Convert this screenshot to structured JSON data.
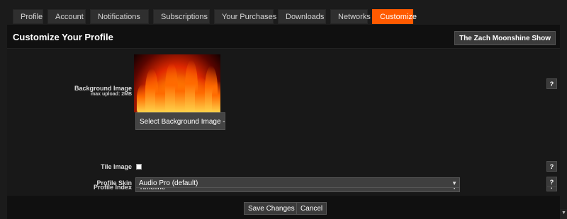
{
  "tabs": [
    {
      "label": "Profile"
    },
    {
      "label": "Account"
    },
    {
      "label": "Notifications"
    },
    {
      "label": "Subscriptions"
    },
    {
      "label": "Your Purchases"
    },
    {
      "label": "Downloads"
    },
    {
      "label": "Networks"
    },
    {
      "label": "Customize",
      "active": true
    }
  ],
  "header": {
    "title": "Customize Your Profile",
    "show_button": "The Zach Moonshine Show"
  },
  "form": {
    "background_image": {
      "label": "Background Image",
      "sublabel": "max upload: 2MB",
      "button": "Select Background Image - JPG",
      "preview_icon": "fire-image"
    },
    "tile_image": {
      "label": "Tile Image",
      "checked": false
    },
    "profile_index": {
      "label": "Profile Index",
      "value": "Timeline"
    },
    "profile_skin": {
      "label": "Profile Skin",
      "value": "Audio Pro (default)"
    },
    "help_glyph": "?"
  },
  "footer": {
    "save": "Save Changes",
    "cancel": "Cancel"
  },
  "colors": {
    "accent": "#ff5a00",
    "background": "#1b1b1b"
  }
}
